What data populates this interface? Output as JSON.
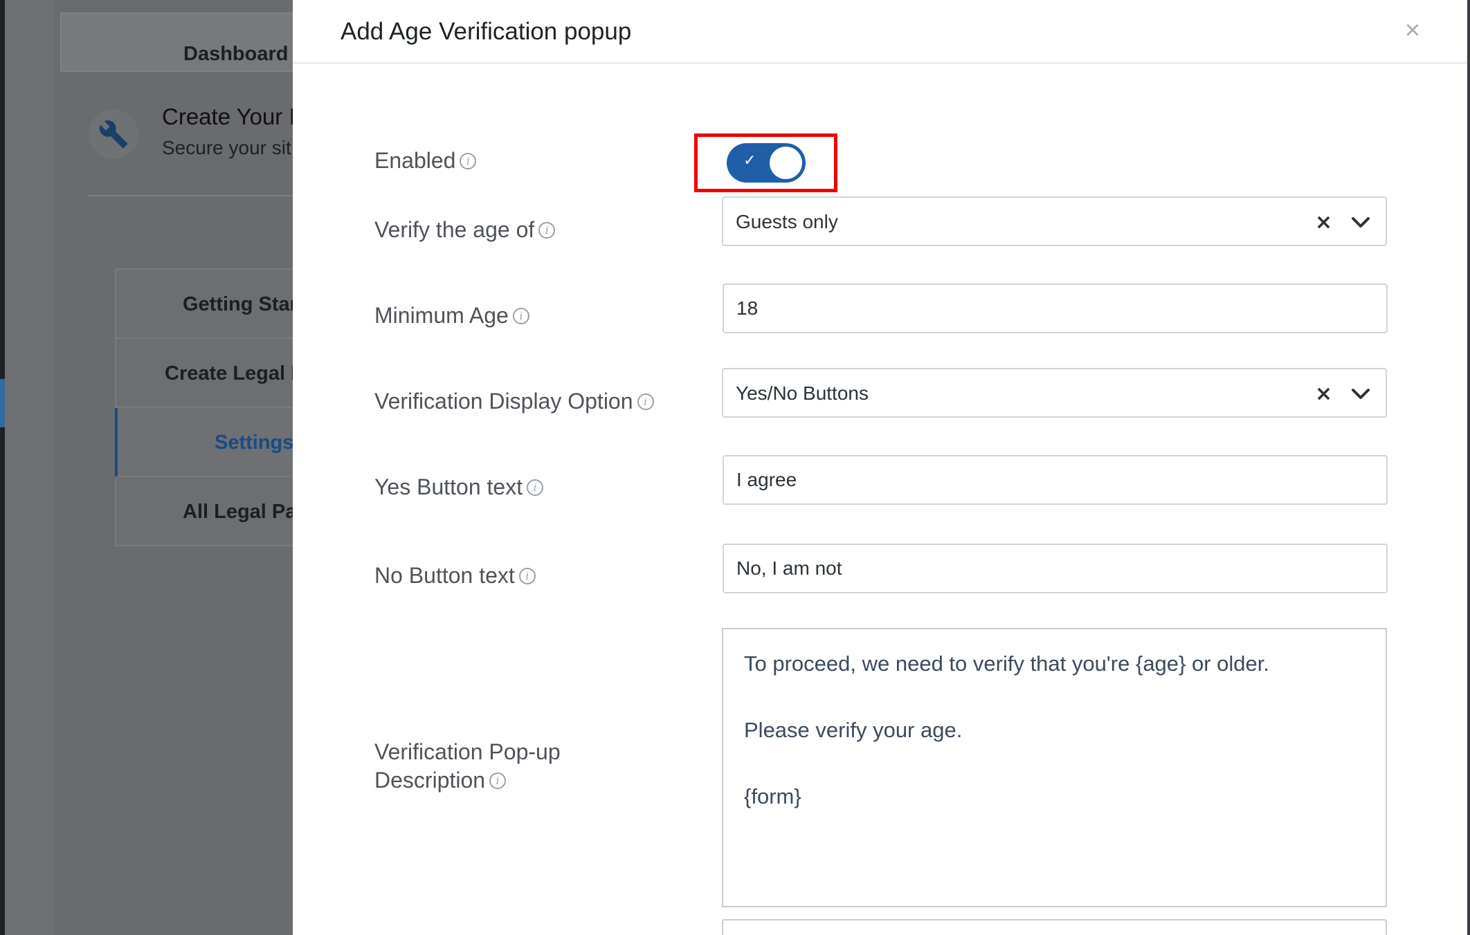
{
  "background": {
    "nav": {
      "dashboard_label": "Dashboard"
    },
    "header": {
      "title": "Create Your I",
      "subtitle": "Secure your sit"
    },
    "menu": [
      {
        "label": "Getting Star"
      },
      {
        "label": "Create Legal P"
      },
      {
        "label": "Settings"
      },
      {
        "label": "All Legal Pa"
      }
    ]
  },
  "modal": {
    "title": "Add Age Verification popup",
    "close_icon": "close-icon",
    "fields": {
      "enabled": {
        "label": "Enabled",
        "value": true
      },
      "verify_age_of": {
        "label": "Verify the age of",
        "value": "Guests only"
      },
      "minimum_age": {
        "label": "Minimum Age",
        "value": "18"
      },
      "display_option": {
        "label": "Verification Display Option",
        "value": "Yes/No Buttons"
      },
      "yes_button_text": {
        "label": "Yes Button text",
        "value": "I agree"
      },
      "no_button_text": {
        "label": "No Button text",
        "value": "No, I am not"
      },
      "description": {
        "label": "Verification Pop-up Description",
        "lines": [
          "To proceed, we need to verify that you're {age} or older.",
          "Please verify your age.",
          "{form}"
        ]
      }
    }
  },
  "colors": {
    "toggle_on": "#1e5fa8",
    "highlight_box": "#ee0000",
    "active_menu": "#1b4a85"
  }
}
